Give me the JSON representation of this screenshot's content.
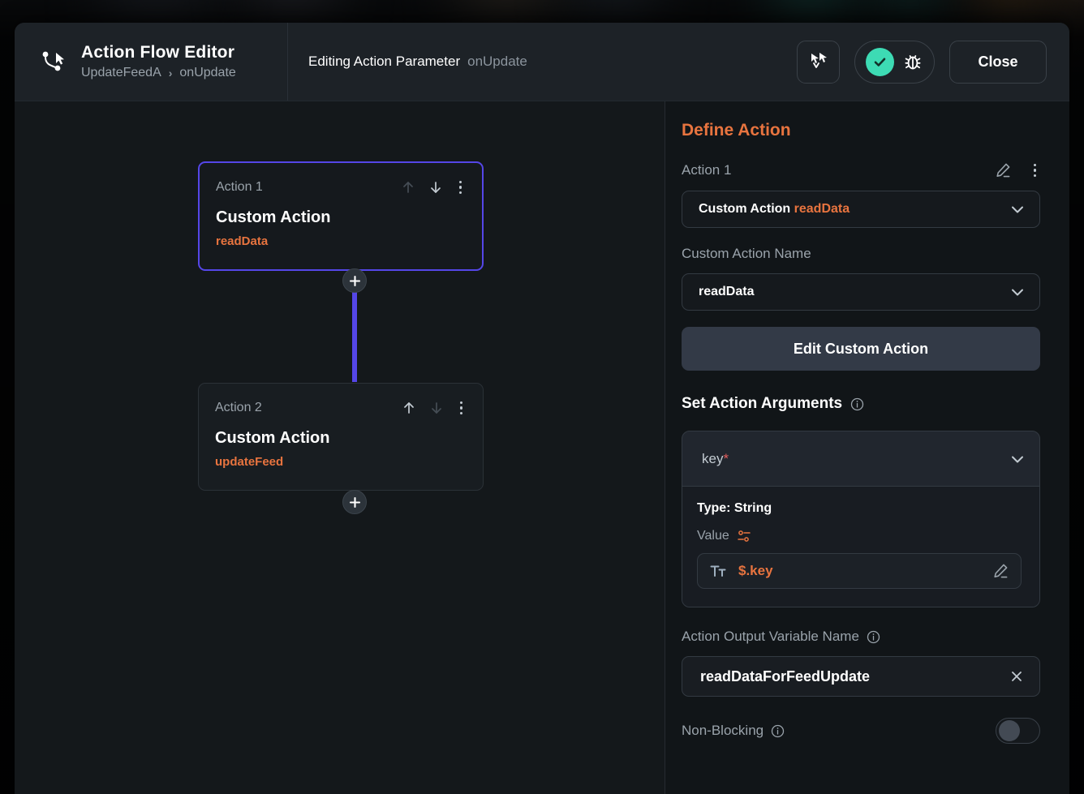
{
  "header": {
    "brand_icon": "node-path-cursor-icon",
    "title": "Action Flow Editor",
    "breadcrumb_root": "UpdateFeedA",
    "breadcrumb_sep": "›",
    "breadcrumb_leaf": "onUpdate",
    "editing_label": "Editing Action Parameter",
    "editing_value": "onUpdate",
    "nav_icon": "flow-cursor-icon",
    "status_icon": "check-icon",
    "debug_icon": "bug-icon",
    "close_label": "Close"
  },
  "canvas": {
    "nodes": [
      {
        "label": "Action 1",
        "title": "Custom Action",
        "subtitle": "readData",
        "selected": true,
        "move_up_enabled": false,
        "move_down_enabled": true
      },
      {
        "label": "Action 2",
        "title": "Custom Action",
        "subtitle": "updateFeed",
        "selected": false,
        "move_up_enabled": true,
        "move_down_enabled": false
      }
    ],
    "add_button_label": "+",
    "connector_color": "#5546e8"
  },
  "panel": {
    "title": "Define Action",
    "action_label": "Action 1",
    "edit_icon": "pencil-icon",
    "more_icon": "kebab-menu-icon",
    "action_select": {
      "prefix": "Custom Action",
      "value": "readData"
    },
    "custom_action_name_label": "Custom Action Name",
    "custom_action_name_value": "readData",
    "edit_custom_action_label": "Edit Custom Action",
    "arguments_heading": "Set Action Arguments",
    "arguments_info_icon": "info-icon",
    "argument": {
      "name": "key",
      "required_marker": "*",
      "type_line": "Type: String",
      "value_label": "Value",
      "value_settings_icon": "sliders-icon",
      "value_format_icon": "text-format-icon",
      "value": "$.key",
      "value_edit_icon": "pencil-icon"
    },
    "output_variable_label": "Action Output Variable Name",
    "output_variable_value": "readDataForFeedUpdate",
    "output_clear_icon": "close-x-icon",
    "non_blocking_label": "Non-Blocking",
    "non_blocking_on": false
  },
  "colors": {
    "accent_orange": "#e8743f",
    "accent_purple": "#5546e8",
    "accent_teal": "#3ddbb4",
    "required_red": "#e35d5d"
  }
}
